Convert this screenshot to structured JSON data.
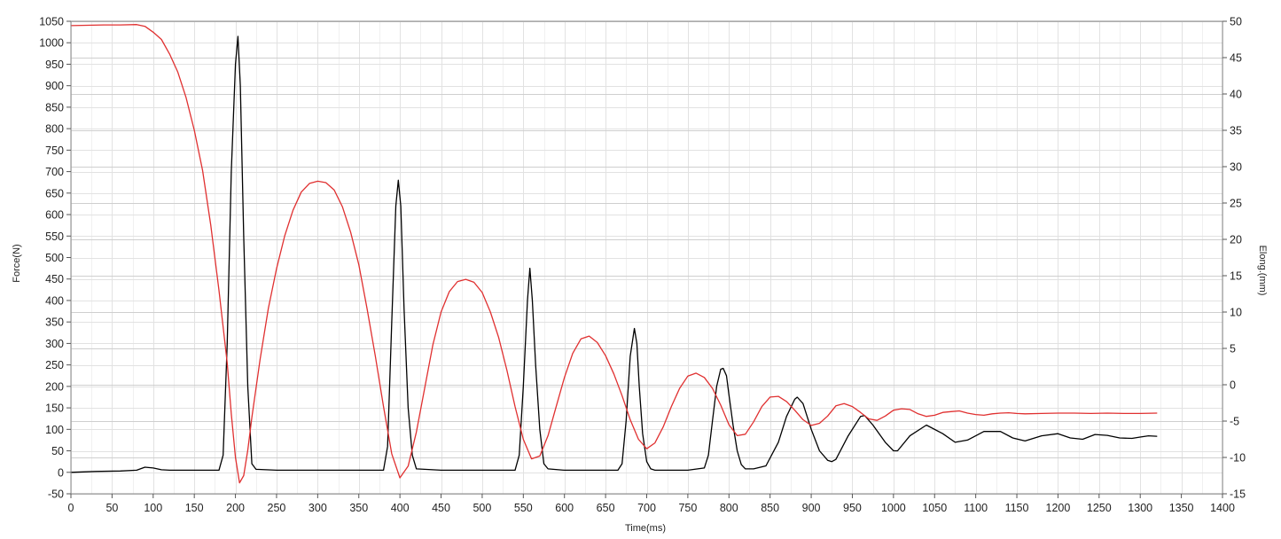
{
  "chart_data": {
    "type": "line",
    "title": "",
    "xlabel": "Time(ms)",
    "ylabel": "Force(N)",
    "y2label": "Elong.(mm)",
    "xlim": [
      0,
      1400
    ],
    "ylim": [
      -50,
      1050
    ],
    "y2lim": [
      -15,
      50
    ],
    "x_ticks": [
      0,
      50,
      100,
      150,
      200,
      250,
      300,
      350,
      400,
      450,
      500,
      550,
      600,
      650,
      700,
      750,
      800,
      850,
      900,
      950,
      1000,
      1050,
      1100,
      1150,
      1200,
      1250,
      1300,
      1350,
      1400
    ],
    "y_ticks": [
      -50,
      0,
      50,
      100,
      150,
      200,
      250,
      300,
      350,
      400,
      450,
      500,
      550,
      600,
      650,
      700,
      750,
      800,
      850,
      900,
      950,
      1000,
      1050
    ],
    "y2_ticks": [
      -15,
      -10,
      -5,
      0,
      5,
      10,
      15,
      20,
      25,
      30,
      35,
      40,
      45,
      50
    ],
    "x_tick_labels": [
      "0",
      "50",
      "100",
      "150",
      "200",
      "250",
      "300",
      "350",
      "400",
      "450",
      "500",
      "550",
      "600",
      "650",
      "700",
      "750",
      "800",
      "850",
      "900",
      "950",
      "1000",
      "1050",
      "1100",
      "1150",
      "1200",
      "1250",
      "1300",
      "1350",
      "1400"
    ],
    "y_tick_labels": [
      "-50",
      "0",
      "50",
      "100",
      "150",
      "200",
      "250",
      "300",
      "350",
      "400",
      "450",
      "500",
      "550",
      "600",
      "650",
      "700",
      "750",
      "800",
      "850",
      "900",
      "950",
      "1000",
      "1050"
    ],
    "y2_tick_labels": [
      "-15",
      "-10",
      "-5",
      "0",
      "5",
      "10",
      "15",
      "20",
      "25",
      "30",
      "35",
      "40",
      "45",
      "50"
    ],
    "grid": true,
    "legend": "none",
    "series": [
      {
        "axis": "left",
        "color": "#000000",
        "x": [
          0,
          30,
          60,
          80,
          90,
          100,
          110,
          120,
          140,
          160,
          180,
          185,
          190,
          195,
          200,
          203,
          206,
          210,
          215,
          220,
          225,
          250,
          300,
          350,
          380,
          385,
          390,
          395,
          398,
          401,
          405,
          410,
          415,
          420,
          450,
          500,
          540,
          545,
          550,
          555,
          558,
          561,
          565,
          570,
          575,
          580,
          600,
          650,
          665,
          670,
          675,
          680,
          685,
          688,
          691,
          695,
          700,
          705,
          710,
          750,
          770,
          775,
          780,
          785,
          790,
          793,
          797,
          800,
          805,
          810,
          815,
          820,
          830,
          845,
          860,
          870,
          880,
          883,
          890,
          900,
          910,
          920,
          925,
          930,
          945,
          960,
          965,
          975,
          990,
          1000,
          1005,
          1020,
          1040,
          1060,
          1075,
          1090,
          1110,
          1130,
          1145,
          1160,
          1180,
          1200,
          1215,
          1230,
          1245,
          1260,
          1275,
          1290,
          1300,
          1310,
          1320
        ],
        "y": [
          0,
          2,
          3,
          5,
          12,
          10,
          6,
          5,
          5,
          5,
          5,
          40,
          300,
          700,
          950,
          1015,
          900,
          550,
          200,
          20,
          7,
          5,
          5,
          5,
          5,
          60,
          350,
          620,
          680,
          620,
          380,
          150,
          40,
          8,
          5,
          5,
          5,
          40,
          200,
          400,
          475,
          400,
          250,
          100,
          20,
          8,
          5,
          5,
          5,
          20,
          120,
          270,
          335,
          300,
          200,
          90,
          25,
          8,
          5,
          5,
          10,
          40,
          120,
          200,
          240,
          242,
          225,
          180,
          110,
          50,
          18,
          8,
          8,
          15,
          70,
          130,
          170,
          175,
          160,
          100,
          50,
          28,
          25,
          30,
          85,
          130,
          132,
          110,
          70,
          50,
          50,
          85,
          110,
          90,
          70,
          75,
          95,
          95,
          80,
          73,
          85,
          90,
          80,
          77,
          88,
          86,
          80,
          79,
          82,
          85,
          84
        ]
      },
      {
        "axis": "right",
        "color": "#e03030",
        "x": [
          0,
          20,
          40,
          60,
          80,
          90,
          100,
          110,
          120,
          130,
          140,
          150,
          160,
          170,
          180,
          190,
          195,
          200,
          205,
          210,
          215,
          220,
          230,
          240,
          250,
          260,
          270,
          280,
          290,
          300,
          310,
          320,
          330,
          340,
          350,
          360,
          370,
          380,
          390,
          400,
          410,
          420,
          430,
          440,
          450,
          460,
          470,
          480,
          490,
          500,
          510,
          520,
          530,
          540,
          550,
          560,
          570,
          580,
          590,
          600,
          610,
          620,
          630,
          640,
          650,
          660,
          670,
          680,
          690,
          700,
          710,
          720,
          730,
          740,
          750,
          760,
          770,
          780,
          790,
          800,
          810,
          820,
          830,
          840,
          850,
          860,
          870,
          880,
          890,
          900,
          910,
          920,
          930,
          940,
          950,
          960,
          970,
          980,
          990,
          1000,
          1010,
          1020,
          1030,
          1040,
          1050,
          1060,
          1070,
          1080,
          1090,
          1100,
          1110,
          1120,
          1130,
          1140,
          1150,
          1160,
          1180,
          1200,
          1220,
          1240,
          1260,
          1280,
          1300,
          1320
        ],
        "y": [
          49.4,
          49.45,
          49.5,
          49.5,
          49.55,
          49.3,
          48.5,
          47.5,
          45.5,
          43,
          39.5,
          35,
          29.5,
          22,
          13,
          3,
          -4,
          -10,
          -13.5,
          -12.5,
          -9,
          -4.5,
          3.5,
          10.5,
          16,
          20.5,
          24,
          26.5,
          27.7,
          28,
          27.8,
          26.8,
          24.5,
          21,
          16.5,
          10.5,
          4,
          -3,
          -9.5,
          -12.8,
          -11.2,
          -6.5,
          -0.5,
          5.5,
          10,
          12.8,
          14.2,
          14.5,
          14.1,
          12.7,
          10,
          6.5,
          2,
          -3,
          -7.5,
          -10.2,
          -9.8,
          -7,
          -3,
          1,
          4.3,
          6.3,
          6.7,
          5.8,
          4,
          1.5,
          -1.5,
          -4.8,
          -7.5,
          -8.8,
          -8,
          -5.8,
          -3,
          -0.5,
          1.2,
          1.6,
          1,
          -0.5,
          -2.8,
          -5.5,
          -7,
          -6.8,
          -5.1,
          -3,
          -1.7,
          -1.6,
          -2.3,
          -3.5,
          -4.8,
          -5.6,
          -5.3,
          -4.3,
          -2.9,
          -2.6,
          -3,
          -3.8,
          -4.7,
          -4.9,
          -4.3,
          -3.5,
          -3.3,
          -3.4,
          -4,
          -4.35,
          -4.2,
          -3.8,
          -3.7,
          -3.6,
          -3.9,
          -4.1,
          -4.2,
          -4,
          -3.9,
          -3.85,
          -3.95,
          -4.0,
          -3.95,
          -3.9,
          -3.9,
          -3.95,
          -3.9,
          -3.95,
          -3.95,
          -3.9
        ]
      }
    ]
  }
}
